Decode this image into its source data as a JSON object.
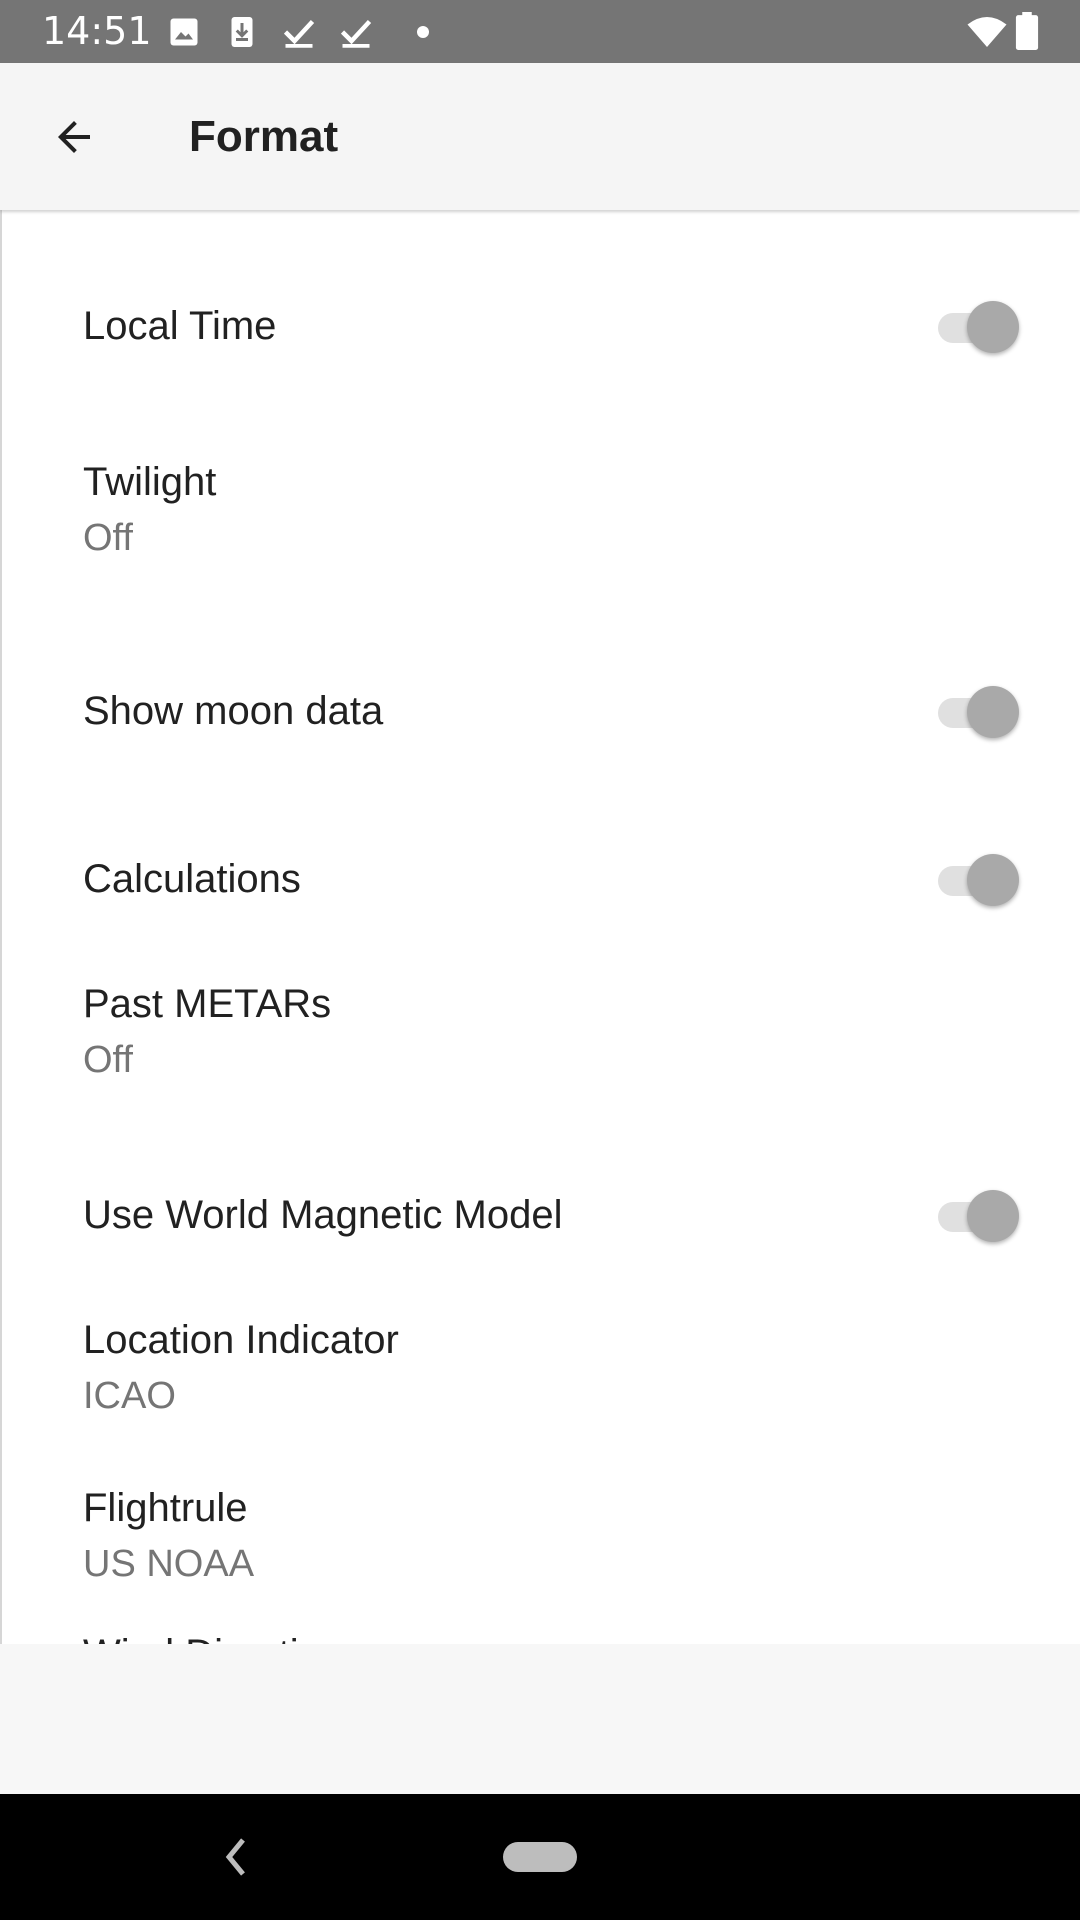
{
  "status_bar": {
    "time": "14:51",
    "icons": [
      "image-icon",
      "download-icon",
      "check-icon",
      "check-icon",
      "dot-icon",
      "wifi-icon",
      "battery-icon"
    ]
  },
  "app_bar": {
    "title": "Format",
    "back_icon": "arrow-back-icon"
  },
  "preferences": [
    {
      "title": "Local Time",
      "type": "switch",
      "checked": true
    },
    {
      "title": "Twilight",
      "type": "list",
      "summary": "Off"
    },
    {
      "title": "Show moon data",
      "type": "switch",
      "checked": true
    },
    {
      "title": "Calculations",
      "type": "switch",
      "checked": true
    },
    {
      "title": "Past METARs",
      "type": "list",
      "summary": "Off"
    },
    {
      "title": "Use World Magnetic Model",
      "type": "switch",
      "checked": true
    },
    {
      "title": "Location Indicator",
      "type": "list",
      "summary": "ICAO"
    },
    {
      "title": "Flightrule",
      "type": "list",
      "summary": "US NOAA"
    },
    {
      "title": "Wind Direction",
      "type": "list"
    }
  ],
  "colors": {
    "status_bar": "#757575",
    "app_bar": "#f5f5f5",
    "switch_thumb": "#a9a9a9",
    "switch_track": "#e0e0e0",
    "summary_text": "#757575"
  },
  "nav_bar": {
    "back_icon": "nav-back-icon",
    "home_icon": "nav-home-pill"
  }
}
